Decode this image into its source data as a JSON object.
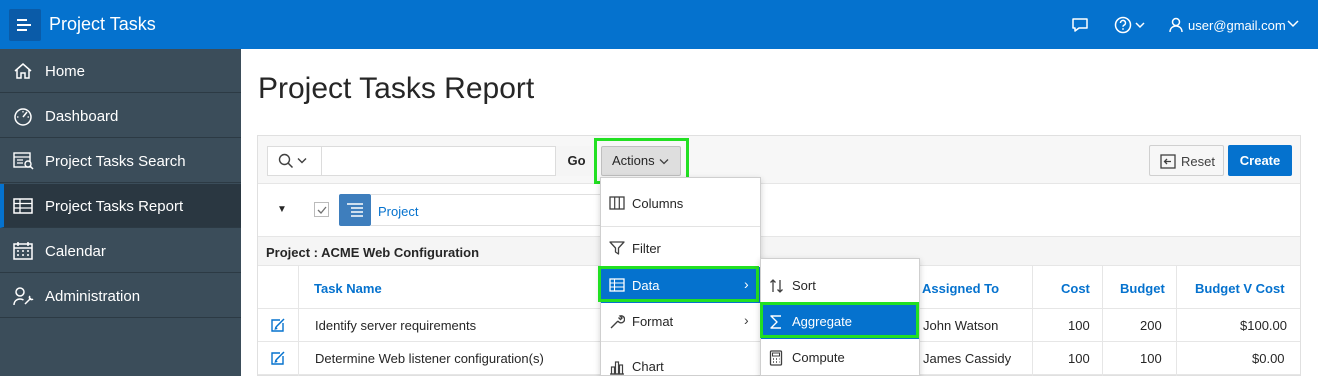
{
  "header": {
    "app_title": "Project Tasks",
    "user": "user@gmail.com"
  },
  "sidebar": {
    "items": [
      {
        "label": "Home",
        "icon": "home-icon"
      },
      {
        "label": "Dashboard",
        "icon": "gauge-icon"
      },
      {
        "label": "Project Tasks Search",
        "icon": "search-list-icon"
      },
      {
        "label": "Project Tasks Report",
        "icon": "table-icon",
        "active": true
      },
      {
        "label": "Calendar",
        "icon": "calendar-icon"
      },
      {
        "label": "Administration",
        "icon": "user-wrench-icon"
      }
    ]
  },
  "page": {
    "title": "Project Tasks Report"
  },
  "toolbar": {
    "go_label": "Go",
    "actions_label": "Actions",
    "reset_label": "Reset",
    "create_label": "Create"
  },
  "filter": {
    "label": "Project"
  },
  "control_break": "Project : ACME Web Configuration",
  "table": {
    "headers": {
      "task_name": "Task Name",
      "assigned_to": "Assigned To",
      "cost": "Cost",
      "budget": "Budget",
      "budget_v_cost": "Budget V Cost"
    },
    "rows": [
      {
        "task_name": "Identify server requirements",
        "assigned_to": "John Watson",
        "cost": "100",
        "budget": "200",
        "budget_v_cost": "$100.00"
      },
      {
        "task_name": "Determine Web listener configuration(s)",
        "assigned_to": "James Cassidy",
        "cost": "100",
        "budget": "100",
        "budget_v_cost": "$0.00"
      }
    ]
  },
  "actions_menu": {
    "items": [
      {
        "label": "Columns",
        "icon": "columns-icon"
      },
      {
        "label": "Filter",
        "icon": "filter-icon"
      },
      {
        "label": "Data",
        "icon": "table-icon",
        "selected": true,
        "submenu": true
      },
      {
        "label": "Format",
        "icon": "wrench-icon",
        "submenu": true
      },
      {
        "label": "Chart",
        "icon": "chart-icon"
      }
    ]
  },
  "data_submenu": {
    "items": [
      {
        "label": "Sort",
        "icon": "sort-icon"
      },
      {
        "label": "Aggregate",
        "icon": "sigma-icon",
        "selected": true
      },
      {
        "label": "Compute",
        "icon": "calculator-icon"
      }
    ]
  },
  "colors": {
    "brand": "#0572ce",
    "sidebar": "#3b4d5a",
    "highlight_outline": "#22e022"
  }
}
